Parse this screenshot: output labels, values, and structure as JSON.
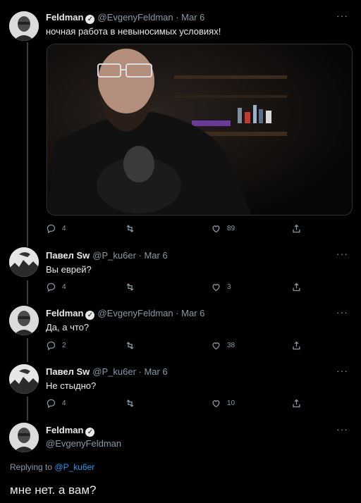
{
  "tweets": [
    {
      "author": "Feldman",
      "handle": "@EvgenyFeldman",
      "time": "Mar 6",
      "text": "ночная работа в невыносимых условиях!",
      "replies": "4",
      "likes": "89"
    },
    {
      "author": "Павел Sw",
      "handle": "@P_ku6er",
      "time": "Mar 6",
      "text": "Вы еврей?",
      "replies": "4",
      "likes": "3"
    },
    {
      "author": "Feldman",
      "handle": "@EvgenyFeldman",
      "time": "Mar 6",
      "text": "Да, а что?",
      "replies": "2",
      "likes": "38"
    },
    {
      "author": "Павел Sw",
      "handle": "@P_ku6er",
      "time": "Mar 6",
      "text": "Не стыдно?",
      "replies": "4",
      "likes": "10"
    }
  ],
  "final_tweet": {
    "author": "Feldman",
    "handle": "@EvgenyFeldman",
    "replying_prefix": "Replying to",
    "replying_handle": "@P_ku6er",
    "text": "мне нет. а вам?"
  },
  "meta": {
    "separator": " · ",
    "more": "···"
  },
  "colors": {
    "background": "#000000",
    "text": "#e7e9ea",
    "muted": "#8b98a5",
    "link": "#1d9bf0",
    "border": "#2f3336"
  },
  "icons": [
    "reply-icon",
    "retweet-icon",
    "like-icon",
    "share-icon",
    "verified-badge-icon",
    "more-options-icon"
  ]
}
